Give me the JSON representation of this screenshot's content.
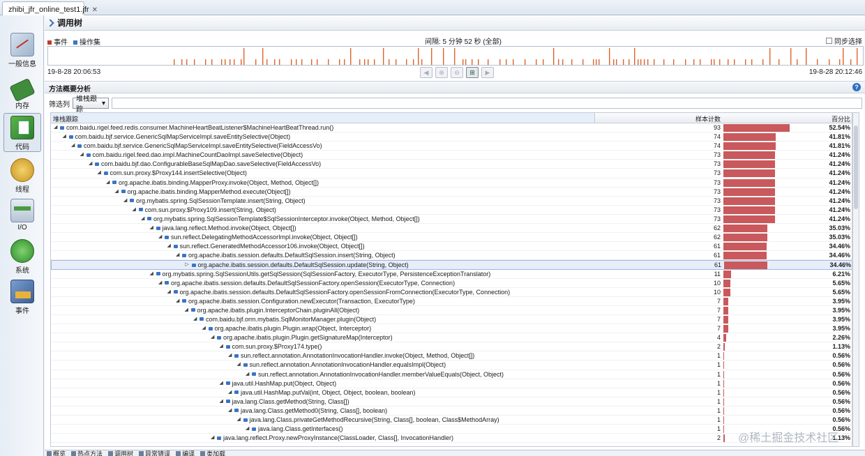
{
  "window": {
    "tab_title": "zhibi_jfr_online_test1.jfr"
  },
  "sidebar": {
    "items": [
      {
        "label": "一般信息"
      },
      {
        "label": "内存"
      },
      {
        "label": "代码"
      },
      {
        "label": "线程"
      },
      {
        "label": "I/O"
      },
      {
        "label": "系统"
      },
      {
        "label": "事件"
      }
    ]
  },
  "view": {
    "title": "调用树",
    "legend": {
      "events": "事件",
      "operations": "操作集"
    },
    "interval": "间隔: 5 分钟 52 秒 (全部)",
    "sync_label": "同步选择",
    "time_start": "19-8-28 20:06:53",
    "time_end": "19-8-28 20:12:46",
    "section_title": "方法概要分析",
    "filter_label": "筛选列",
    "filter_value": "堆栈跟踪",
    "columns": {
      "stack": "堆栈跟踪",
      "count": "样本计数",
      "percent": "百分比"
    },
    "colors": {
      "bar": "#c9595c",
      "timeline_event": "#e0622a"
    }
  },
  "rows": [
    {
      "method": "com.baidu.rigel.feed.redis.consumer.MachineHeartBeatListener$MachineHeartBeatThread.run()",
      "count": "93",
      "percent": "52.54%",
      "depth": 0
    },
    {
      "method": "com.baidu.bjf.service.GenericSqlMapServiceImpl.saveEntitySelective(Object)",
      "count": "74",
      "percent": "41.81%",
      "depth": 1
    },
    {
      "method": "com.baidu.bjf.service.GenericSqlMapServiceImpl.saveEntitySelective(FieldAccessVo)",
      "count": "74",
      "percent": "41.81%",
      "depth": 2
    },
    {
      "method": "com.baidu.rigel.feed.dao.impl.MachineCountDaoImpl.saveSelective(Object)",
      "count": "73",
      "percent": "41.24%",
      "depth": 3
    },
    {
      "method": "com.baidu.bjf.dao.ConfigurableBaseSqlMapDao.saveSelective(FieldAccessVo)",
      "count": "73",
      "percent": "41.24%",
      "depth": 4
    },
    {
      "method": "com.sun.proxy.$Proxy144.insertSelective(Object)",
      "count": "73",
      "percent": "41.24%",
      "depth": 5
    },
    {
      "method": "org.apache.ibatis.binding.MapperProxy.invoke(Object, Method, Object[])",
      "count": "73",
      "percent": "41.24%",
      "depth": 6
    },
    {
      "method": "org.apache.ibatis.binding.MapperMethod.execute(Object[])",
      "count": "73",
      "percent": "41.24%",
      "depth": 7
    },
    {
      "method": "org.mybatis.spring.SqlSessionTemplate.insert(String, Object)",
      "count": "73",
      "percent": "41.24%",
      "depth": 8
    },
    {
      "method": "com.sun.proxy.$Proxy109.insert(String, Object)",
      "count": "73",
      "percent": "41.24%",
      "depth": 9
    },
    {
      "method": "org.mybatis.spring.SqlSessionTemplate$SqlSessionInterceptor.invoke(Object, Method, Object[])",
      "count": "73",
      "percent": "41.24%",
      "depth": 10
    },
    {
      "method": "java.lang.reflect.Method.invoke(Object, Object[])",
      "count": "62",
      "percent": "35.03%",
      "depth": 11
    },
    {
      "method": "sun.reflect.DelegatingMethodAccessorImpl.invoke(Object, Object[])",
      "count": "62",
      "percent": "35.03%",
      "depth": 12
    },
    {
      "method": "sun.reflect.GeneratedMethodAccessor106.invoke(Object, Object[])",
      "count": "61",
      "percent": "34.46%",
      "depth": 13
    },
    {
      "method": "org.apache.ibatis.session.defaults.DefaultSqlSession.insert(String, Object)",
      "count": "61",
      "percent": "34.46%",
      "depth": 14
    },
    {
      "method": "org.apache.ibatis.session.defaults.DefaultSqlSession.update(String, Object)",
      "count": "61",
      "percent": "34.46%",
      "depth": 15,
      "selected": true
    },
    {
      "method": "org.mybatis.spring.SqlSessionUtils.getSqlSession(SqlSessionFactory, ExecutorType, PersistenceExceptionTranslator)",
      "count": "11",
      "percent": "6.21%",
      "depth": 11
    },
    {
      "method": "org.apache.ibatis.session.defaults.DefaultSqlSessionFactory.openSession(ExecutorType, Connection)",
      "count": "10",
      "percent": "5.65%",
      "depth": 12
    },
    {
      "method": "org.apache.ibatis.session.defaults.DefaultSqlSessionFactory.openSessionFromConnection(ExecutorType, Connection)",
      "count": "10",
      "percent": "5.65%",
      "depth": 13
    },
    {
      "method": "org.apache.ibatis.session.Configuration.newExecutor(Transaction, ExecutorType)",
      "count": "7",
      "percent": "3.95%",
      "depth": 14
    },
    {
      "method": "org.apache.ibatis.plugin.InterceptorChain.pluginAll(Object)",
      "count": "7",
      "percent": "3.95%",
      "depth": 15
    },
    {
      "method": "com.baidu.bjf.orm.mybatis.SqlMonitorManager.plugin(Object)",
      "count": "7",
      "percent": "3.95%",
      "depth": 16
    },
    {
      "method": "org.apache.ibatis.plugin.Plugin.wrap(Object, Interceptor)",
      "count": "7",
      "percent": "3.95%",
      "depth": 17
    },
    {
      "method": "org.apache.ibatis.plugin.Plugin.getSignatureMap(Interceptor)",
      "count": "4",
      "percent": "2.26%",
      "depth": 18
    },
    {
      "method": "com.sun.proxy.$Proxy174.type()",
      "count": "2",
      "percent": "1.13%",
      "depth": 19
    },
    {
      "method": "sun.reflect.annotation.AnnotationInvocationHandler.invoke(Object, Method, Object[])",
      "count": "1",
      "percent": "0.56%",
      "depth": 20
    },
    {
      "method": "sun.reflect.annotation.AnnotationInvocationHandler.equalsImpl(Object)",
      "count": "1",
      "percent": "0.56%",
      "depth": 21
    },
    {
      "method": "sun.reflect.annotation.AnnotationInvocationHandler.memberValueEquals(Object, Object)",
      "count": "1",
      "percent": "0.56%",
      "depth": 22
    },
    {
      "method": "java.util.HashMap.put(Object, Object)",
      "count": "1",
      "percent": "0.56%",
      "depth": 19
    },
    {
      "method": "java.util.HashMap.putVal(int, Object, Object, boolean, boolean)",
      "count": "1",
      "percent": "0.56%",
      "depth": 20
    },
    {
      "method": "java.lang.Class.getMethod(String, Class[])",
      "count": "1",
      "percent": "0.56%",
      "depth": 19
    },
    {
      "method": "java.lang.Class.getMethod0(String, Class[], boolean)",
      "count": "1",
      "percent": "0.56%",
      "depth": 20
    },
    {
      "method": "java.lang.Class.privateGetMethodRecursive(String, Class[], boolean, Class$MethodArray)",
      "count": "1",
      "percent": "0.56%",
      "depth": 21
    },
    {
      "method": "java.lang.Class.getInterfaces()",
      "count": "1",
      "percent": "0.56%",
      "depth": 22
    },
    {
      "method": "java.lang.reflect.Proxy.newProxyInstance(ClassLoader, Class[], InvocationHandler)",
      "count": "2",
      "percent": "1.13%",
      "depth": 18
    }
  ],
  "bottom_tabs": [
    {
      "label": "概览"
    },
    {
      "label": "热点方法"
    },
    {
      "label": "调用树"
    },
    {
      "label": "异常错误"
    },
    {
      "label": "编译"
    },
    {
      "label": "类加载"
    }
  ],
  "watermark": "@稀土掘金技术社区"
}
